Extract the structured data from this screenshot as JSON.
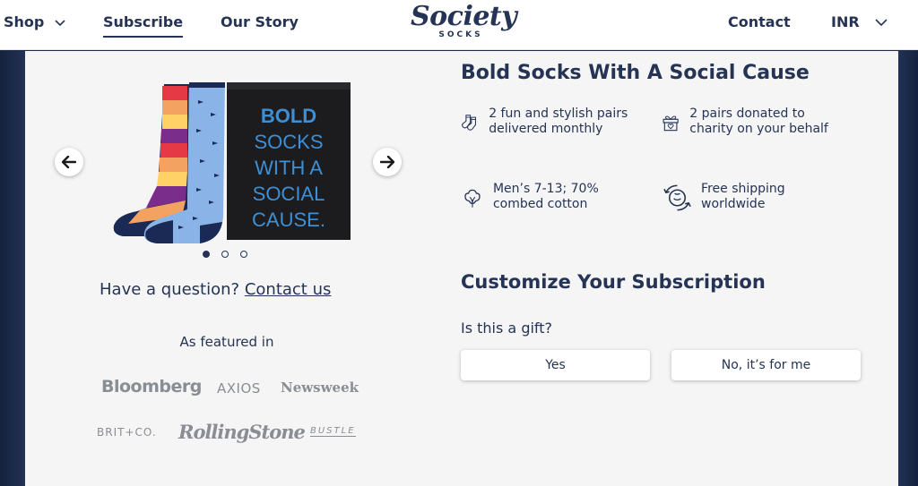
{
  "nav": {
    "shop": "Shop",
    "subscribe": "Subscribe",
    "our_story": "Our Story",
    "contact": "Contact",
    "currency": "INR"
  },
  "logo": {
    "main": "Society",
    "sub": "SOCKS"
  },
  "carousel": {
    "package_text": [
      "BOLD",
      "SOCKS",
      "WITH A",
      "SOCIAL",
      "CAUSE."
    ],
    "slide_count": 3,
    "active_slide": 1
  },
  "question": {
    "prefix": "Have a question?",
    "link": "Contact us"
  },
  "featured": {
    "heading": "As featured in",
    "outlets": [
      "Bloomberg",
      "AXIOS",
      "Newsweek",
      "BRIT+CO.",
      "RollingStone",
      "BUSTLE"
    ]
  },
  "product": {
    "title": "Bold Socks With A Social Cause",
    "features": [
      {
        "icon": "socks-icon",
        "text": "2 fun and stylish pairs delivered monthly"
      },
      {
        "icon": "gift-heart-icon",
        "text": "2 pairs donated to charity on your behalf"
      },
      {
        "icon": "cotton-icon",
        "text": "Men’s 7-13; 70% combed cotton"
      },
      {
        "icon": "shipping-globe-icon",
        "text": "Free shipping worldwide"
      }
    ]
  },
  "customize": {
    "title": "Customize Your Subscription",
    "gift_question": "Is this a gift?",
    "yes_label": "Yes",
    "no_label": "No, it’s for me"
  },
  "colors": {
    "navy": "#253354",
    "panel": "#f5f5f5",
    "package": "#1c1c1e",
    "package_text": "#3d8fd6"
  }
}
